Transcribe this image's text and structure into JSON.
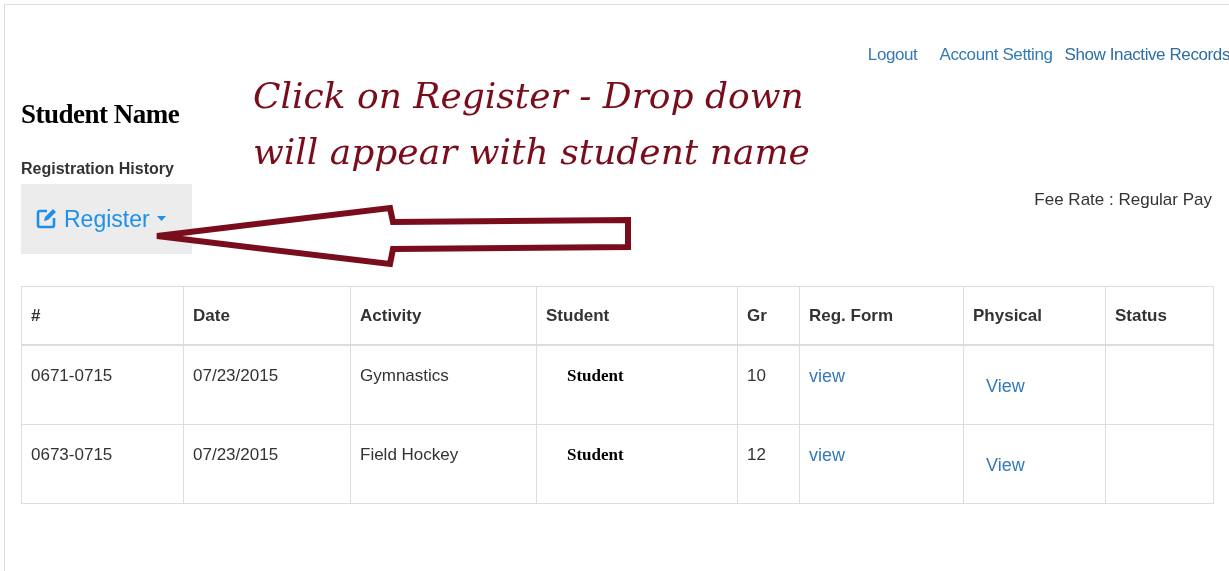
{
  "header_links": [
    "Logout",
    "Account Setting",
    "Show Inactive Records"
  ],
  "student_name": "Student Name",
  "section_title": "Registration History",
  "register_button": "Register",
  "fee_rate": "Fee Rate : Regular Pay",
  "annotation": [
    "Click on Register - Drop down",
    "will appear with student name"
  ],
  "table": {
    "columns": [
      "#",
      "Date",
      "Activity",
      "Student",
      "Gr",
      "Reg. Form",
      "Physical",
      "Status"
    ],
    "rows": [
      {
        "number": "0671-0715",
        "date": "07/23/2015",
        "activity": "Gymnastics",
        "student": "Student",
        "grade": "10",
        "reg_form": "view",
        "physical": "View"
      },
      {
        "number": "0673-0715",
        "date": "07/23/2015",
        "activity": "Field Hockey",
        "student": "Student",
        "grade": "12",
        "reg_form": "view",
        "physical": "View"
      }
    ]
  }
}
